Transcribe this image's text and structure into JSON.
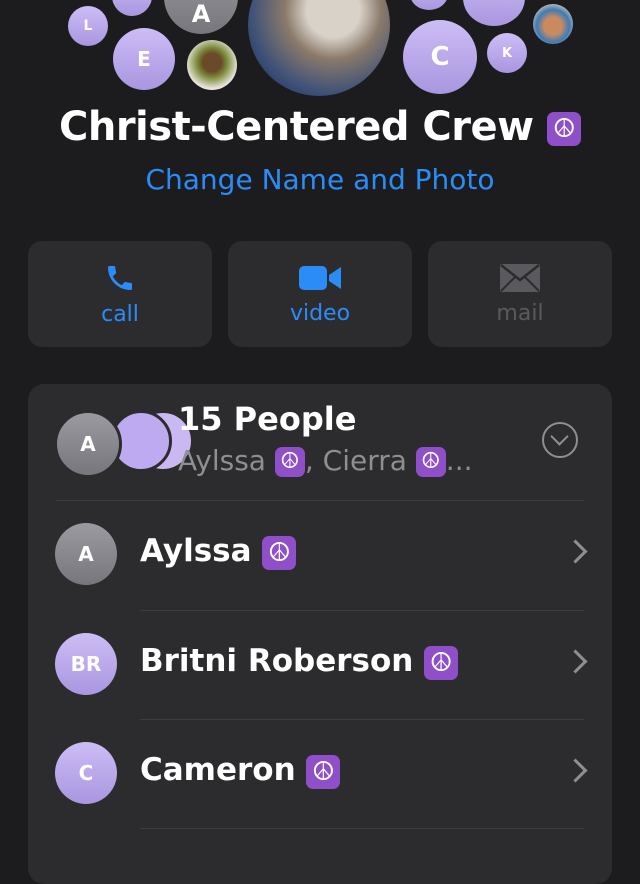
{
  "header": {
    "bubbles": [
      {
        "kind": "initial",
        "text": "L",
        "style": "purple"
      },
      {
        "kind": "initial",
        "text": "A",
        "style": "gray"
      },
      {
        "kind": "initial",
        "text": "E",
        "style": "purple"
      },
      {
        "kind": "initial",
        "text": "C",
        "style": "purple"
      },
      {
        "kind": "initial",
        "text": "K",
        "style": "purple"
      }
    ],
    "title": "Christ-Centered Crew",
    "title_emoji": "☮",
    "change_label": "Change Name and Photo"
  },
  "actions": {
    "call": {
      "label": "call",
      "icon": "phone-icon",
      "enabled": true
    },
    "video": {
      "label": "video",
      "icon": "video-camera-icon",
      "enabled": true
    },
    "mail": {
      "label": "mail",
      "icon": "envelope-icon",
      "enabled": false
    }
  },
  "group": {
    "avatar_initial": "A",
    "title": "15 People",
    "subtitle_a": "Aylssa",
    "subtitle_b": ", Cierra",
    "subtitle_ellipsis": "..."
  },
  "members": [
    {
      "initials": "A",
      "name": "Aylssa",
      "style": "gray"
    },
    {
      "initials": "BR",
      "name": "Britni Roberson",
      "style": "purple"
    },
    {
      "initials": "C",
      "name": "Cameron",
      "style": "purple"
    }
  ],
  "colors": {
    "accent": "#2b8cf7",
    "background": "#1c1c1e",
    "card": "#2c2c2e",
    "emoji_bg": "#8e4fc9"
  }
}
